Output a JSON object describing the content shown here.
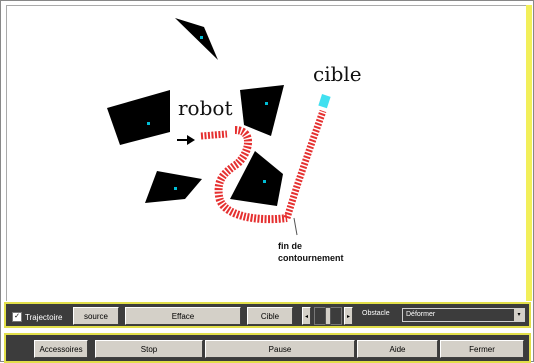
{
  "scene": {
    "labels": {
      "cible": "cible",
      "robot": "robot",
      "fin_line1": "fin de",
      "fin_line2": "contournement"
    },
    "colors": {
      "obstacle": "#000000",
      "marker": "#00bcd4",
      "path": "#e53030",
      "target": "#40e0f0"
    }
  },
  "toolbar1": {
    "trajectoire_label": "Trajectoire",
    "trajectoire_checked": true,
    "source_label": "source",
    "efface_label": "Efface",
    "cible_label": "Cible",
    "left_arrow": "◂",
    "right_arrow": "▸",
    "obstacle_label": "Obstacle",
    "obstacle_value": "Déformer",
    "dropdown_icon": "▾"
  },
  "toolbar2": {
    "accessoires_label": "Accessoires",
    "stop_label": "Stop",
    "pause_label": "Pause",
    "aide_label": "Aide",
    "fermer_label": "Fermer"
  },
  "accent_color": "#e2df4a"
}
